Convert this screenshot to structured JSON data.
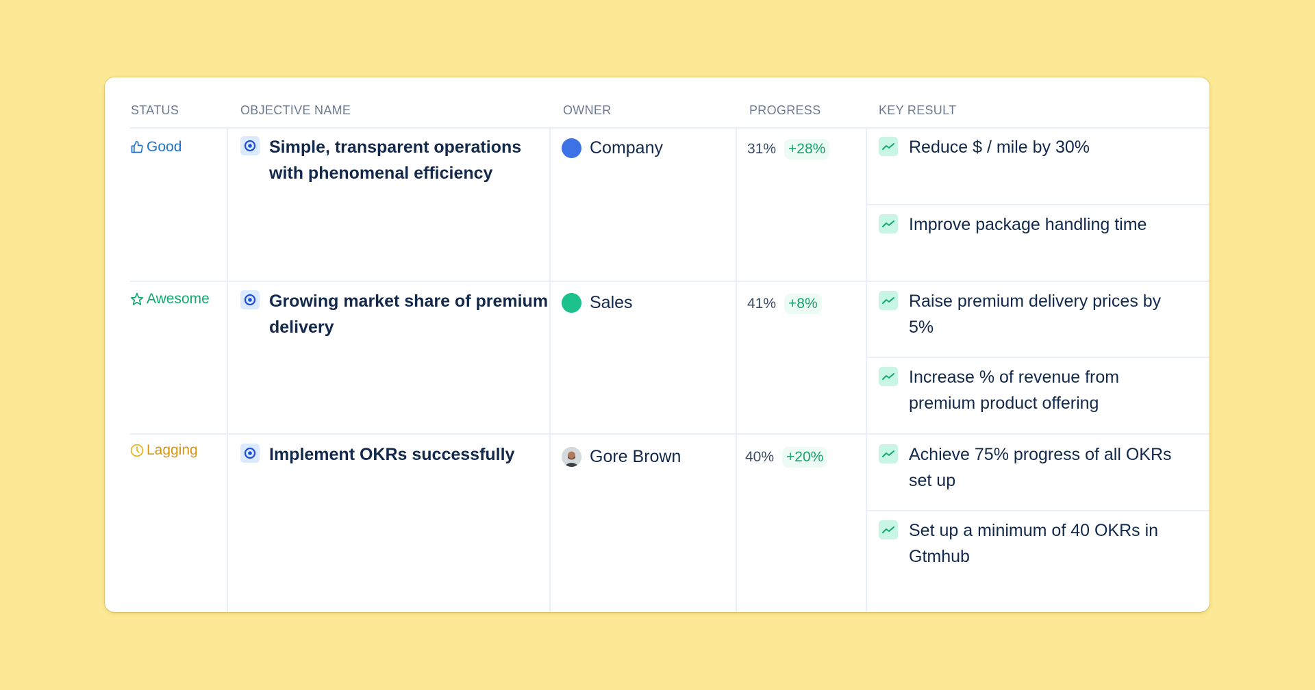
{
  "table": {
    "headers": {
      "status": "STATUS",
      "objective": "OBJECTIVE NAME",
      "owner": "OWNER",
      "progress": "PROGRESS",
      "key_result": "KEY RESULT"
    },
    "rows": [
      {
        "status": {
          "label": "Good",
          "icon": "thumbs-up-icon",
          "color": "#1f6fd1"
        },
        "objective": {
          "name": "Simple, transparent operations with phenomenal efficiency",
          "icon": "target-icon"
        },
        "owner": {
          "name": "Company",
          "type": "dot",
          "color": "#3d72e6"
        },
        "progress": {
          "percent": "31%",
          "change": "+28%"
        },
        "key_results": [
          {
            "text": "Reduce $ / mile by 30%",
            "icon": "trend-up-icon"
          },
          {
            "text": "Improve package handling time",
            "icon": "trend-up-icon"
          }
        ]
      },
      {
        "status": {
          "label": "Awesome",
          "icon": "star-icon",
          "color": "#12a86f"
        },
        "objective": {
          "name": "Growing market share of premium delivery",
          "icon": "target-icon"
        },
        "owner": {
          "name": "Sales",
          "type": "dot",
          "color": "#1cc08a"
        },
        "progress": {
          "percent": "41%",
          "change": "+8%"
        },
        "key_results": [
          {
            "text": "Raise premium delivery prices by 5%",
            "icon": "trend-up-icon"
          },
          {
            "text": "Increase % of revenue from premium product offering",
            "icon": "trend-up-icon"
          }
        ]
      },
      {
        "status": {
          "label": "Lagging",
          "icon": "clock-icon",
          "color": "#d9950f"
        },
        "objective": {
          "name": "Implement OKRs successfully",
          "icon": "target-icon"
        },
        "owner": {
          "name": "Gore Brown",
          "type": "avatar"
        },
        "progress": {
          "percent": "40%",
          "change": "+20%"
        },
        "key_results": [
          {
            "text": "Achieve 75% progress of all OKRs set up",
            "icon": "trend-up-icon"
          },
          {
            "text": "Set up a minimum of 40 OKRs in Gtmhub",
            "icon": "trend-up-icon"
          }
        ]
      }
    ]
  },
  "colors": {
    "background": "#fde995",
    "card": "#ffffff",
    "positive": "#17a36b",
    "objective_icon": "#1d4ed8"
  }
}
